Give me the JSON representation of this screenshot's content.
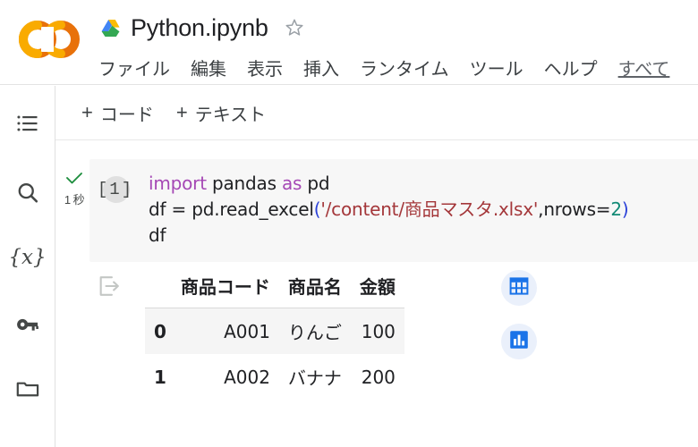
{
  "header": {
    "logo_name": "colab-logo",
    "drive_icon_name": "google-drive-icon",
    "doc_title": "Python.ipynb",
    "star_icon_name": "star-outline-icon",
    "menu_items": [
      {
        "label": "ファイル",
        "name": "menu-file"
      },
      {
        "label": "編集",
        "name": "menu-edit"
      },
      {
        "label": "表示",
        "name": "menu-view"
      },
      {
        "label": "挿入",
        "name": "menu-insert"
      },
      {
        "label": "ランタイム",
        "name": "menu-runtime"
      },
      {
        "label": "ツール",
        "name": "menu-tools"
      },
      {
        "label": "ヘルプ",
        "name": "menu-help"
      }
    ],
    "save_status": "すべて"
  },
  "sidebar": {
    "items": [
      {
        "name": "table-of-contents-icon",
        "label": "目次"
      },
      {
        "name": "search-icon",
        "label": "検索"
      },
      {
        "name": "variables-icon",
        "label": "変数"
      },
      {
        "name": "key-icon",
        "label": "シークレット"
      },
      {
        "name": "folder-icon",
        "label": "ファイル"
      }
    ]
  },
  "toolbar": {
    "add_code_label": "コード",
    "add_text_label": "テキスト",
    "plus": "+"
  },
  "cell": {
    "execution_count": "[1]",
    "status_icon": "check-icon",
    "exec_time": "1 秒",
    "code_lines": [
      "import pandas as pd",
      "df = pd.read_excel('/content/商品マスタ.xlsx',nrows=2)",
      "df"
    ],
    "code_tokens": {
      "l1_kw_import": "import",
      "l1_module": " pandas ",
      "l1_kw_as": "as",
      "l1_alias": " pd",
      "l2_pre": "df = pd.read_excel",
      "l2_open": "(",
      "l2_string": "'/content/商品マスタ.xlsx'",
      "l2_comma": ",nrows=",
      "l2_num": "2",
      "l2_close": ")",
      "l3": "df"
    },
    "colors": {
      "keyword": "#a548b5",
      "string": "#a4373a",
      "number": "#128a76",
      "paren": "#2b41d8",
      "cell_bg": "#f7f7f7",
      "text": "#202124"
    }
  },
  "output": {
    "output_icon_name": "open-in-new-output-icon",
    "table": {
      "index_header": "",
      "columns": [
        "商品コード",
        "商品名",
        "金額"
      ],
      "rows": [
        {
          "index": "0",
          "cells": [
            "A001",
            "りんご",
            "100"
          ]
        },
        {
          "index": "1",
          "cells": [
            "A002",
            "バナナ",
            "200"
          ]
        }
      ]
    },
    "actions": [
      {
        "name": "interactive-table-icon",
        "label": "インタラクティブ テーブル",
        "color": "#1a73e8"
      },
      {
        "name": "chart-suggestion-icon",
        "label": "グラフの候補",
        "color": "#1a73e8"
      }
    ]
  }
}
